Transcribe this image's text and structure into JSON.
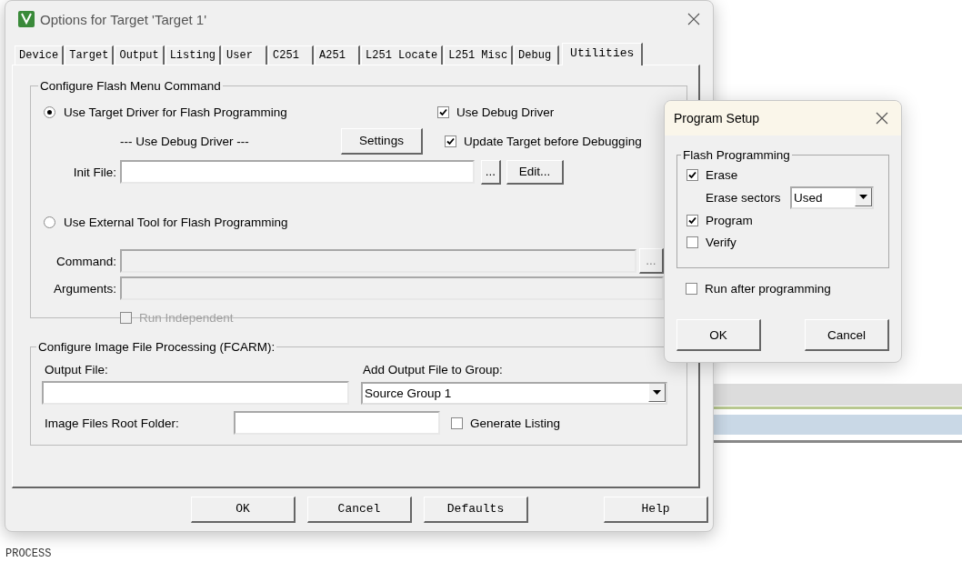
{
  "background": {
    "editor_text": "PROCESS"
  },
  "window": {
    "title": "Options for Target 'Target 1'"
  },
  "tabs": [
    {
      "label": "Device",
      "selected": false
    },
    {
      "label": "Target",
      "selected": false
    },
    {
      "label": "Output",
      "selected": false
    },
    {
      "label": "Listing",
      "selected": false
    },
    {
      "label": "User",
      "selected": false
    },
    {
      "label": "C251",
      "selected": false
    },
    {
      "label": "A251",
      "selected": false
    },
    {
      "label": "L251 Locate",
      "selected": false
    },
    {
      "label": "L251 Misc",
      "selected": false
    },
    {
      "label": "Debug",
      "selected": false
    },
    {
      "label": "Utilities",
      "selected": true
    }
  ],
  "flash_menu": {
    "title": "Configure Flash Menu Command",
    "options": [
      {
        "label": "Use Target Driver for Flash Programming",
        "selected": true
      },
      {
        "label": "Use External Tool for Flash Programming",
        "selected": false
      }
    ],
    "driver": "--- Use Debug Driver ---",
    "settings_button": "Settings",
    "checks": [
      {
        "label": "Use Debug Driver",
        "checked": true
      },
      {
        "label": "Update Target before Debugging",
        "checked": true
      }
    ],
    "init_file": {
      "label": "Init File:",
      "browse": "...",
      "edit": "Edit..."
    },
    "command": {
      "label": "Command:",
      "browse": "...",
      "disabled": true
    },
    "arguments": {
      "label": "Arguments:",
      "disabled": true
    },
    "run_independent": {
      "label": "Run Independent",
      "checked": false,
      "disabled": true
    }
  },
  "image_processing": {
    "title": "Configure Image File Processing (FCARM):",
    "output_file_label": "Output File:",
    "group_label": "Add Output File  to Group:",
    "group_value": "Source Group 1",
    "root_folder_label": "Image Files Root Folder:",
    "generate_listing": {
      "label": "Generate Listing",
      "checked": false
    }
  },
  "buttons": [
    "OK",
    "Cancel",
    "Defaults",
    "Help"
  ],
  "program_setup": {
    "title": "Program Setup",
    "group": "Flash Programming",
    "erase": {
      "label": "Erase",
      "checked": true
    },
    "sectors_label": "Erase sectors",
    "sectors_value": "Used",
    "program": {
      "label": "Program",
      "checked": true
    },
    "verify": {
      "label": "Verify",
      "checked": false
    },
    "run_after": {
      "label": "Run after programming",
      "checked": false
    },
    "buttons": [
      "OK",
      "Cancel"
    ]
  }
}
